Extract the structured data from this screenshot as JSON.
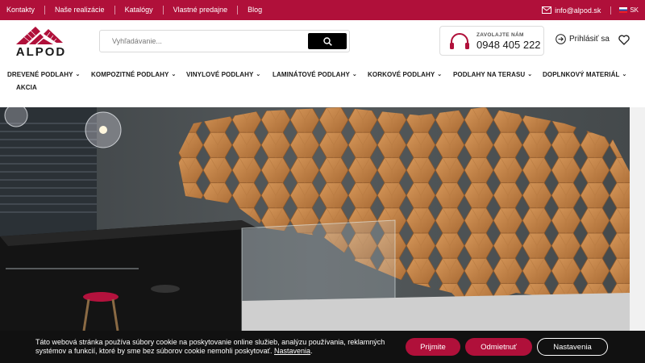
{
  "topbar": {
    "links": [
      "Kontakty",
      "Naše realizácie",
      "Katalógy",
      "Vlastné predajne",
      "Blog"
    ],
    "email": "info@alpod.sk",
    "language": "SK"
  },
  "brand": {
    "name": "ALPOD"
  },
  "search": {
    "placeholder": "Vyhľadávanie..."
  },
  "contact": {
    "label": "ZAVOLAJTE NÁM",
    "phone": "0948 405 222"
  },
  "account": {
    "login_label": "Prihlásiť sa"
  },
  "nav": {
    "items": [
      "DREVENÉ PODLAHY",
      "KOMPOZITNÉ PODLAHY",
      "VINYLOVÉ PODLAHY",
      "LAMINÁTOVÉ PODLAHY",
      "KORKOVÉ PODLAHY",
      "PODLAHY NA TERASU",
      "DOPLNKOVÝ MATERIÁL",
      "AKCIA"
    ]
  },
  "cookie": {
    "text": "Táto webová stránka používa súbory cookie na poskytovanie online služieb, analýzu používania, reklamných systémov a funkcií, ktoré by sme bez súborov cookie nemohli poskytovať.",
    "link": "Nastavenia",
    "accept": "Prijmite",
    "reject": "Odmietnuť",
    "settings": "Nastavenia"
  },
  "colors": {
    "brand": "#b0103a",
    "dark": "#111111"
  }
}
